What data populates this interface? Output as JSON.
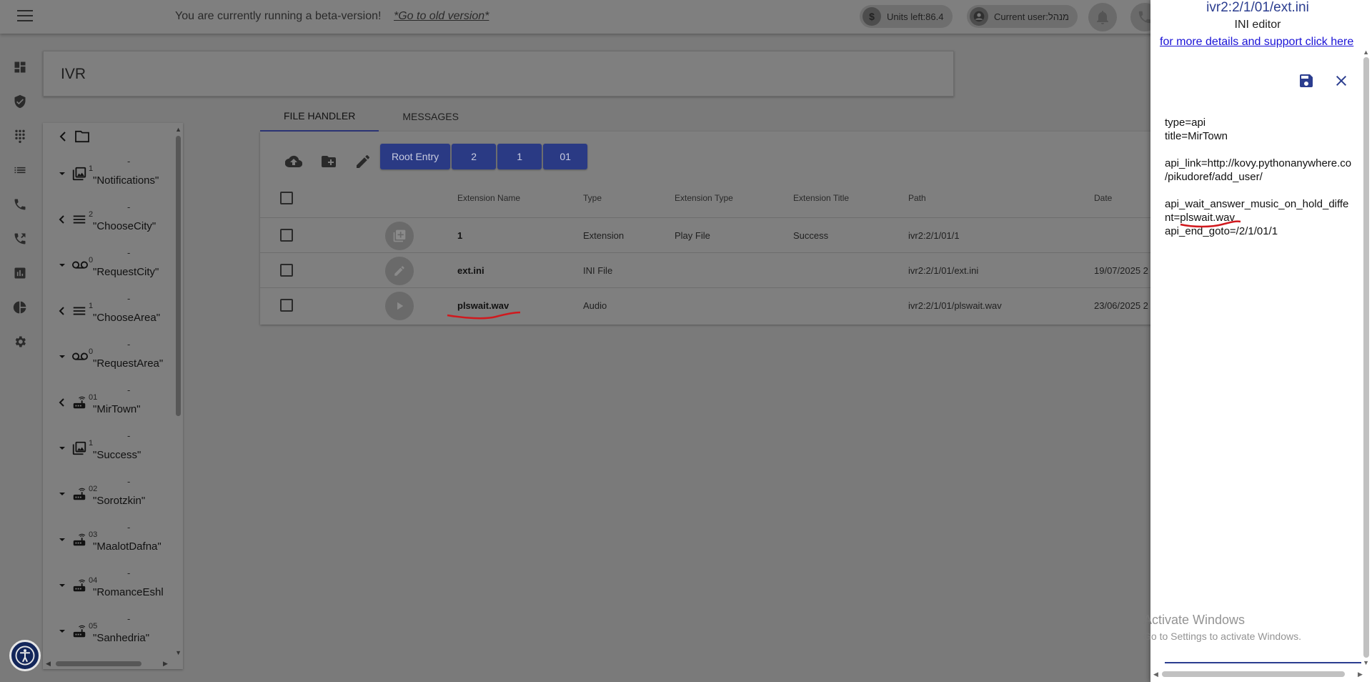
{
  "topbar": {
    "beta_text": "You are currently running a beta-version!",
    "old_version_link": "*Go to old version*",
    "units_label": "Units left:86.4",
    "user_label": "Current user:מנהל",
    "units_icon": "$"
  },
  "page": {
    "title": "IVR"
  },
  "tree": {
    "nodes": [
      {
        "num": "1",
        "dash": "-",
        "name": "\"Notifications\"",
        "expanded": true,
        "icon": "gallery-icon"
      },
      {
        "num": "2",
        "dash": "-",
        "name": "\"ChooseCity\"",
        "expanded": false,
        "icon": "list-icon"
      },
      {
        "num": "0",
        "dash": "-",
        "name": "\"RequestCity\"",
        "expanded": true,
        "icon": "voicemail-icon"
      },
      {
        "num": "1",
        "dash": "-",
        "name": "\"ChooseArea\"",
        "expanded": false,
        "icon": "list-icon"
      },
      {
        "num": "0",
        "dash": "-",
        "name": "\"RequestArea\"",
        "expanded": true,
        "icon": "voicemail-icon"
      },
      {
        "num": "01",
        "dash": "-",
        "name": "\"MirTown\"",
        "expanded": false,
        "icon": "router-icon"
      },
      {
        "num": "1",
        "dash": "-",
        "name": "\"Success\"",
        "expanded": true,
        "icon": "gallery-icon"
      },
      {
        "num": "02",
        "dash": "-",
        "name": "\"Sorotzkin\"",
        "expanded": true,
        "icon": "router-icon"
      },
      {
        "num": "03",
        "dash": "-",
        "name": "\"MaalotDafna\"",
        "expanded": true,
        "icon": "router-icon"
      },
      {
        "num": "04",
        "dash": "-",
        "name": "\"RomanceEshl",
        "expanded": true,
        "icon": "router-icon"
      },
      {
        "num": "05",
        "dash": "-",
        "name": "\"Sanhedria\"",
        "expanded": true,
        "icon": "router-icon"
      }
    ]
  },
  "tabs": [
    {
      "label": "FILE HANDLER",
      "active": true
    },
    {
      "label": "MESSAGES",
      "active": false
    }
  ],
  "breadcrumbs": [
    "Root Entry",
    "2",
    "1",
    "01"
  ],
  "table": {
    "headers": {
      "name": "Extension Name",
      "type": "Type",
      "ext_type": "Extension Type",
      "ext_title": "Extension Title",
      "path": "Path",
      "date": "Date"
    },
    "rows": [
      {
        "name": "1",
        "type": "Extension",
        "ext_type": "Play File",
        "ext_title": "Success",
        "path": "ivr2:2/1/01/1",
        "date": "",
        "icon": "gallery-icon"
      },
      {
        "name": "ext.ini",
        "type": "INI File",
        "ext_type": "",
        "ext_title": "",
        "path": "ivr2:2/1/01/ext.ini",
        "date": "19/07/2025 2",
        "icon": "pencil-icon"
      },
      {
        "name": "plswait.wav",
        "type": "Audio",
        "ext_type": "",
        "ext_title": "",
        "path": "ivr2:2/1/01/plswait.wav",
        "date": "23/06/2025 2",
        "icon": "play-icon"
      }
    ]
  },
  "editor": {
    "title": "ivr2:2/1/01/ext.ini",
    "subtitle": "INI editor",
    "support_link": "for more details and support click here",
    "content": "type=api\ntitle=MirTown\n\napi_link=http://kovy.pythonanywhere.co\n/pikudoref/add_user/\n\napi_wait_answer_music_on_hold_diffe\nnt=plswait.wav\napi_end_goto=/2/1/01/1"
  },
  "watermark": {
    "line1": "Activate Windows",
    "line2": "Go to Settings to activate Windows."
  },
  "colors": {
    "accent": "#2a3a84",
    "link": "#1a12d6",
    "annotation": "#d0191e"
  }
}
